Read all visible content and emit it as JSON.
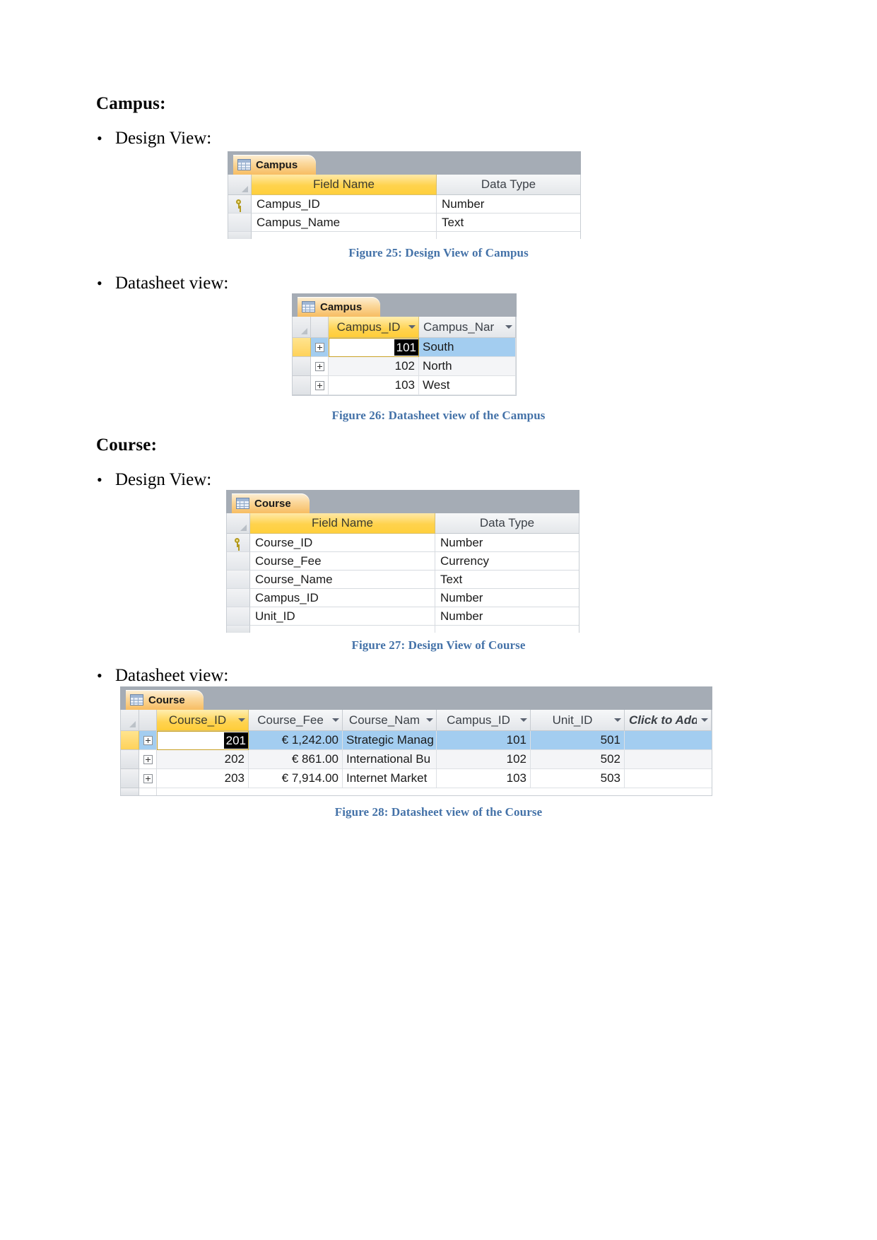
{
  "sections": [
    {
      "title": "Campus",
      "colon": ":"
    },
    {
      "title": "Course",
      "colon": ":"
    }
  ],
  "bullets": {
    "design_view": "Design View:",
    "datasheet_view": "Datasheet view:"
  },
  "captions": {
    "fig25": "Figure 25: Design View of Campus",
    "fig26": "Figure 26: Datasheet view of the Campus",
    "fig27": "Figure 27: Design View of Course",
    "fig28": "Figure 28: Datasheet view of the Course"
  },
  "campus_design": {
    "tab_label": "Campus",
    "tab_icon": "table-icon",
    "columns": [
      "Field Name",
      "Data Type"
    ],
    "rows": [
      {
        "key": true,
        "field": "Campus_ID",
        "type": "Number"
      },
      {
        "key": false,
        "field": "Campus_Name",
        "type": "Text"
      }
    ]
  },
  "campus_datasheet": {
    "tab_label": "Campus",
    "tab_icon": "table-icon",
    "columns": [
      {
        "label": "Campus_ID",
        "active": true
      },
      {
        "label": "Campus_Nar",
        "active": false
      }
    ],
    "rows": [
      {
        "id": "101",
        "name": "South",
        "selected": true,
        "editing": true
      },
      {
        "id": "102",
        "name": "North",
        "selected": false,
        "editing": false
      },
      {
        "id": "103",
        "name": "West",
        "selected": false,
        "editing": false
      }
    ]
  },
  "course_design": {
    "tab_label": "Course",
    "tab_icon": "table-icon",
    "columns": [
      "Field Name",
      "Data Type"
    ],
    "rows": [
      {
        "key": true,
        "field": "Course_ID",
        "type": "Number"
      },
      {
        "key": false,
        "field": "Course_Fee",
        "type": "Currency"
      },
      {
        "key": false,
        "field": "Course_Name",
        "type": "Text"
      },
      {
        "key": false,
        "field": "Campus_ID",
        "type": "Number"
      },
      {
        "key": false,
        "field": "Unit_ID",
        "type": "Number"
      }
    ]
  },
  "course_datasheet": {
    "tab_label": "Course",
    "tab_icon": "table-icon",
    "columns": [
      {
        "label": "Course_ID",
        "active": true
      },
      {
        "label": "Course_Fee",
        "active": false
      },
      {
        "label": "Course_Nam",
        "active": false
      },
      {
        "label": "Campus_ID",
        "active": false
      },
      {
        "label": "Unit_ID",
        "active": false
      },
      {
        "label": "Click to Add",
        "active": false
      }
    ],
    "rows": [
      {
        "course_id": "201",
        "fee": "€ 1,242.00",
        "name": "Strategic Manag",
        "campus_id": "101",
        "unit_id": "501",
        "selected": true,
        "editing": true
      },
      {
        "course_id": "202",
        "fee": "€ 861.00",
        "name": "International Bu",
        "campus_id": "102",
        "unit_id": "502",
        "selected": false,
        "editing": false
      },
      {
        "course_id": "203",
        "fee": "€ 7,914.00",
        "name": "Internet Market",
        "campus_id": "103",
        "unit_id": "503",
        "selected": false,
        "editing": false
      }
    ]
  },
  "colors": {
    "caption_blue": "#4472a8",
    "access_tab_orange": "#f7bd62",
    "header_yellow": "#ffd34d",
    "selected_row_blue": "#a3cdf0",
    "titlebar_gray": "#a5acb5"
  }
}
